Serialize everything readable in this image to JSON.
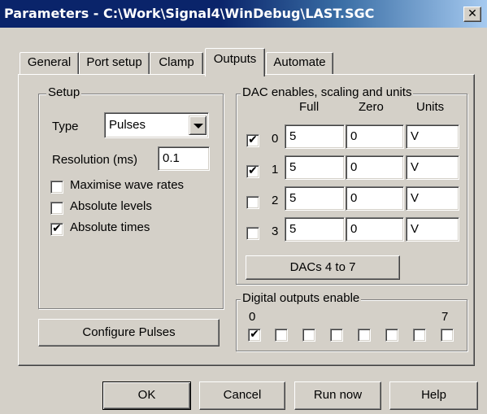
{
  "window": {
    "title": "Parameters - C:\\Work\\Signal4\\WinDebug\\LAST.SGC",
    "close_glyph": "✕"
  },
  "tabs": [
    "General",
    "Port setup",
    "Clamp",
    "Outputs",
    "Automate"
  ],
  "active_tab": "Outputs",
  "setup": {
    "legend": "Setup",
    "type_label": "Type",
    "type_value": "Pulses",
    "resolution_label": "Resolution (ms)",
    "resolution_value": "0.1",
    "checks": [
      {
        "label": "Maximise wave rates",
        "checked": false
      },
      {
        "label": "Absolute levels",
        "checked": false
      },
      {
        "label": "Absolute times",
        "checked": true
      }
    ]
  },
  "dac": {
    "legend": "DAC enables, scaling and units",
    "col_full": "Full",
    "col_zero": "Zero",
    "col_units": "Units",
    "rows": [
      {
        "index": "0",
        "enabled": true,
        "full": "5",
        "zero": "0",
        "units": "V"
      },
      {
        "index": "1",
        "enabled": true,
        "full": "5",
        "zero": "0",
        "units": "V"
      },
      {
        "index": "2",
        "enabled": false,
        "full": "5",
        "zero": "0",
        "units": "V"
      },
      {
        "index": "3",
        "enabled": false,
        "full": "5",
        "zero": "0",
        "units": "V"
      }
    ],
    "more_button": "DACs 4 to 7"
  },
  "digital": {
    "legend": "Digital outputs enable",
    "first_label": "0",
    "last_label": "7",
    "bits": [
      true,
      false,
      false,
      false,
      false,
      false,
      false,
      false
    ]
  },
  "configure_button": "Configure Pulses",
  "footer": {
    "ok": "OK",
    "cancel": "Cancel",
    "run_now": "Run now",
    "help": "Help"
  },
  "check_glyph": "✔"
}
